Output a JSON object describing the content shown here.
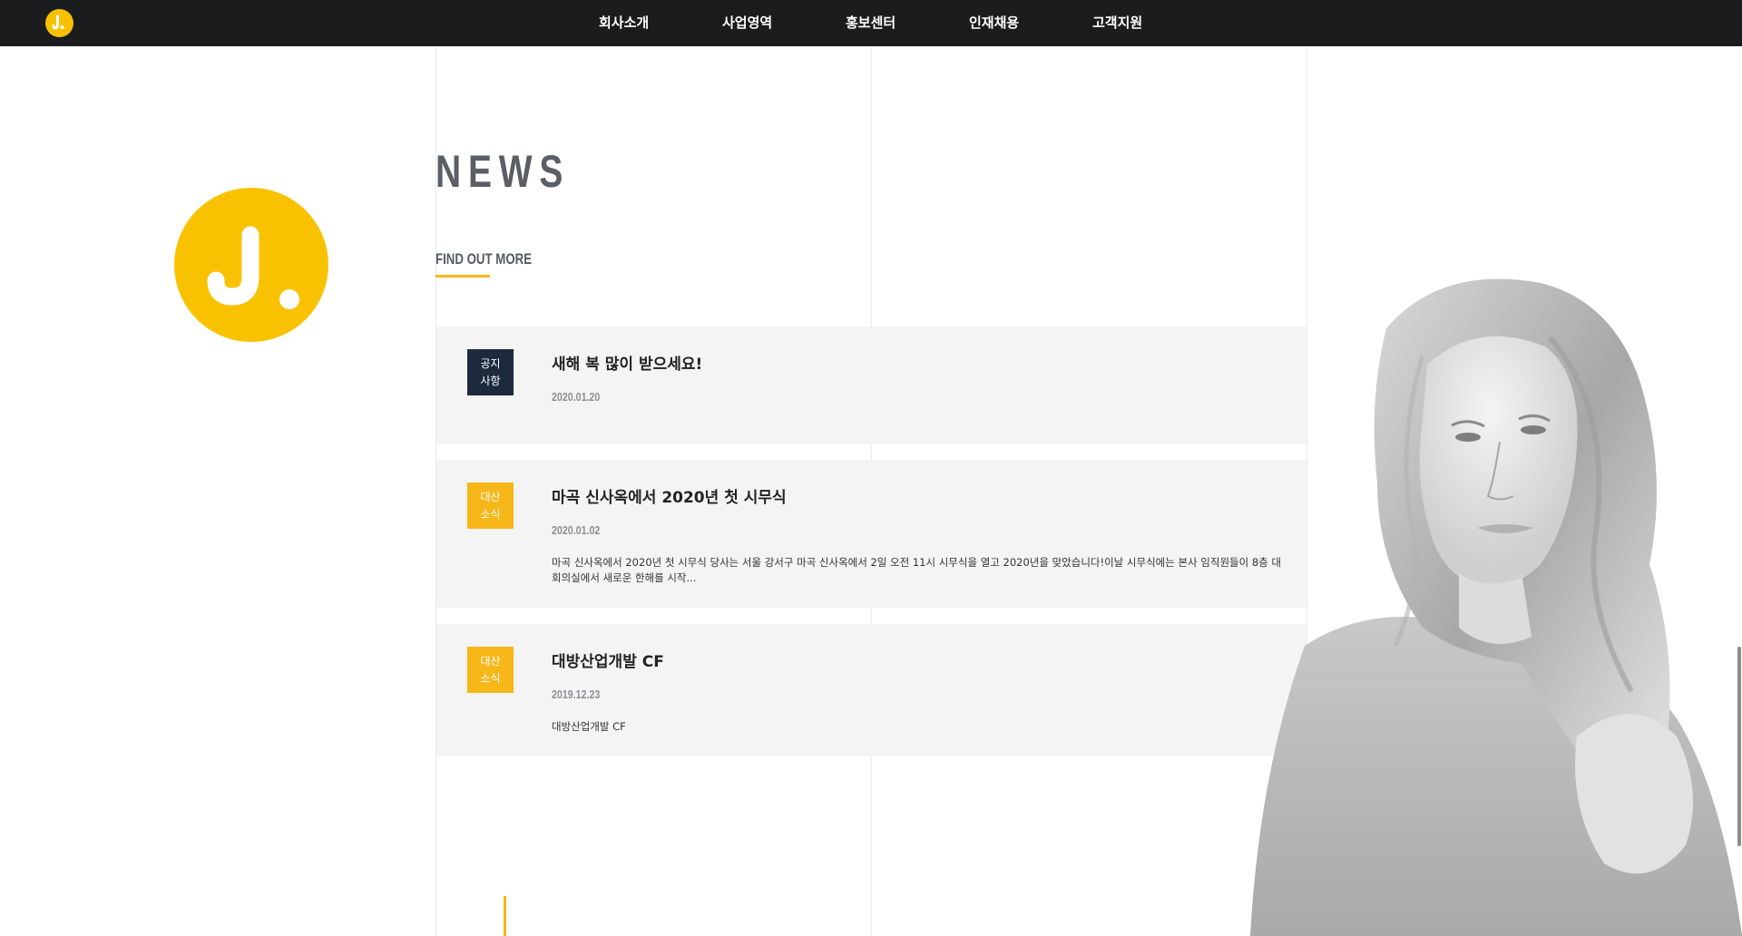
{
  "nav": {
    "items": [
      {
        "label": "회사소개"
      },
      {
        "label": "사업영역"
      },
      {
        "label": "홍보센터"
      },
      {
        "label": "인재채용"
      },
      {
        "label": "고객지원"
      }
    ]
  },
  "news": {
    "title": "NEWS",
    "find_more": "FIND OUT MORE"
  },
  "cards": [
    {
      "badge_line1": "공지",
      "badge_line2": "사항",
      "badge_color": "#1d2a3d",
      "title": "새해 복 많이 받으세요!",
      "date": "2020.01.20",
      "text": ""
    },
    {
      "badge_line1": "대산",
      "badge_line2": "소식",
      "badge_color": "#f7b719",
      "title": "마곡 신사옥에서 2020년 첫 시무식",
      "date": "2020.01.02",
      "text": "마곡 신사옥에서 2020년 첫 시무식 당사는 서울 강서구 마곡 신사옥에서 2일 오전 11시 시무식을 열고 2020년을 맞았습니다!이날 시무식에는 본사 임직원들이 8층 대회의실에서 새로운 한해를 시작..."
    },
    {
      "badge_line1": "대산",
      "badge_line2": "소식",
      "badge_color": "#f7b719",
      "title": "대방산업개발 CF",
      "date": "2019.12.23",
      "text": "대방산업개발 CF"
    }
  ],
  "colors": {
    "accent": "#f7b719",
    "logo_yellow": "#f9c200",
    "topbar": "#1b1c1d",
    "notice_badge": "#1d2a3d"
  },
  "icons": {
    "site_logo": "yellow-circle-logo-icon"
  }
}
